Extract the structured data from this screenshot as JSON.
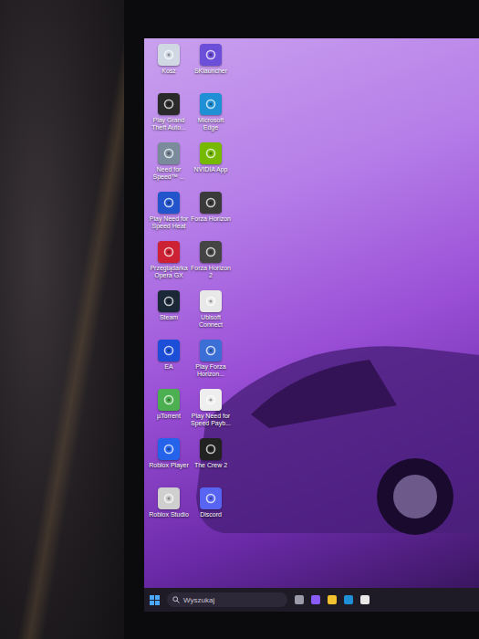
{
  "desktop": {
    "icons": [
      {
        "label": "Kosz",
        "color": "#cfd8e3"
      },
      {
        "label": "SKlauncher",
        "color": "#6b4fd8"
      },
      {
        "label": "Play Grand Theft Auto...",
        "color": "#2a2a2a"
      },
      {
        "label": "Microsoft Edge",
        "color": "#1f8fd6"
      },
      {
        "label": "Need for Speed™ ...",
        "color": "#7a8b9c"
      },
      {
        "label": "NVIDIA App",
        "color": "#76b900"
      },
      {
        "label": "Play Need for Speed Heat",
        "color": "#2255cc"
      },
      {
        "label": "Forza Horizon",
        "color": "#3a3a3a"
      },
      {
        "label": "Przeglądarka Opera GX",
        "color": "#cc2233"
      },
      {
        "label": "Forza Horizon 2",
        "color": "#444444"
      },
      {
        "label": "Steam",
        "color": "#1b2838"
      },
      {
        "label": "Ubisoft Connect",
        "color": "#e8e8e8"
      },
      {
        "label": "EA",
        "color": "#1d4ed8"
      },
      {
        "label": "Play Forza Horizon...",
        "color": "#3b6fd6"
      },
      {
        "label": "µTorrent",
        "color": "#4caf50"
      },
      {
        "label": "Play Need for Speed Payb...",
        "color": "#eeeeee"
      },
      {
        "label": "Roblox Player",
        "color": "#2563eb"
      },
      {
        "label": "The Crew 2",
        "color": "#222222"
      },
      {
        "label": "Roblox Studio",
        "color": "#cfcfcf"
      },
      {
        "label": "Discord",
        "color": "#5865f2"
      }
    ]
  },
  "taskbar": {
    "search": {
      "placeholder": "Wyszukaj"
    }
  }
}
